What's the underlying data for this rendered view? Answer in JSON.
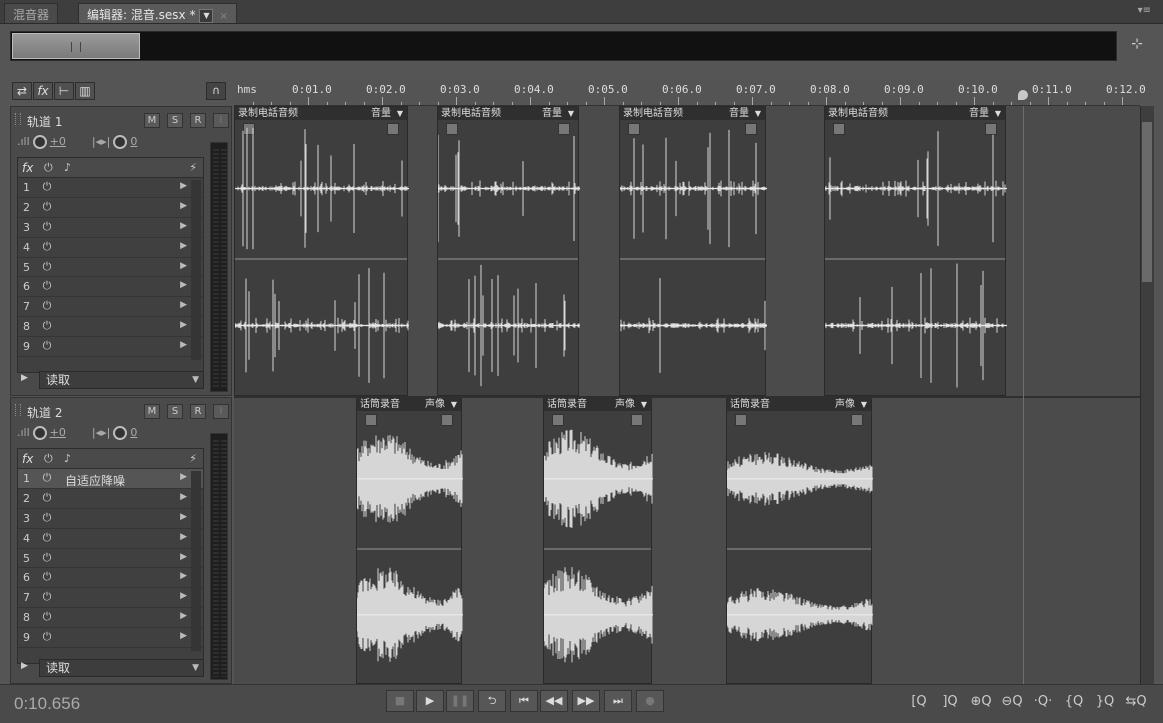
{
  "tabs": {
    "mixer": "混音器",
    "editor": "编辑器: 混音.sesx *",
    "close": "×"
  },
  "panel_menu": "▾≡",
  "toolbar": {
    "switch": "⇄",
    "fx": "fx",
    "sends": "⊢",
    "eq": "▥",
    "monitor": "∩"
  },
  "ruler": {
    "unit": "hms",
    "ticks": [
      "0:01.0",
      "0:02.0",
      "0:03.0",
      "0:04.0",
      "0:05.0",
      "0:06.0",
      "0:07.0",
      "0:08.0",
      "0:09.0",
      "0:10.0",
      "0:11.0",
      "0:12.0"
    ]
  },
  "playhead_time_s": 10.656,
  "tracks": [
    {
      "name": "轨道 1",
      "mute": "M",
      "solo": "S",
      "record": "R",
      "volume": "+0",
      "pan": "0",
      "fx_label": "fx",
      "fx_slots": [
        {
          "num": "1",
          "name": ""
        },
        {
          "num": "2",
          "name": ""
        },
        {
          "num": "3",
          "name": ""
        },
        {
          "num": "4",
          "name": ""
        },
        {
          "num": "5",
          "name": ""
        },
        {
          "num": "6",
          "name": ""
        },
        {
          "num": "7",
          "name": ""
        },
        {
          "num": "8",
          "name": ""
        },
        {
          "num": "9",
          "name": ""
        }
      ],
      "automation": "读取",
      "clips": [
        {
          "name": "录制电話音频",
          "fx": "音量"
        },
        {
          "name": "录制电話音频",
          "fx": "音量"
        },
        {
          "name": "录制电話音频",
          "fx": "音量"
        },
        {
          "name": "录制电話音频",
          "fx": "音量"
        }
      ]
    },
    {
      "name": "轨道 2",
      "mute": "M",
      "solo": "S",
      "record": "R",
      "volume": "+0",
      "pan": "0",
      "fx_label": "fx",
      "fx_slots": [
        {
          "num": "1",
          "name": "自适应降噪"
        },
        {
          "num": "2",
          "name": ""
        },
        {
          "num": "3",
          "name": ""
        },
        {
          "num": "4",
          "name": ""
        },
        {
          "num": "5",
          "name": ""
        },
        {
          "num": "6",
          "name": ""
        },
        {
          "num": "7",
          "name": ""
        },
        {
          "num": "8",
          "name": ""
        },
        {
          "num": "9",
          "name": ""
        }
      ],
      "automation": "读取",
      "clips": [
        {
          "name": "话筒录音",
          "fx": "声像"
        },
        {
          "name": "话筒录音",
          "fx": "声像"
        },
        {
          "name": "话筒录音",
          "fx": "声像"
        }
      ]
    }
  ],
  "timecode": "0:10.656",
  "transport": {
    "stop": "■",
    "play": "▶",
    "pause": "❚❚",
    "loop": "⮌",
    "to_start": "⏮",
    "rewind": "◀◀",
    "forward": "▶▶",
    "to_end": "⏭",
    "record": "●"
  },
  "zoom_buttons": [
    "[Q",
    "]Q",
    "⊕Q",
    "⊖Q",
    "·Q·",
    "{Q",
    "}Q",
    "⇆Q"
  ]
}
